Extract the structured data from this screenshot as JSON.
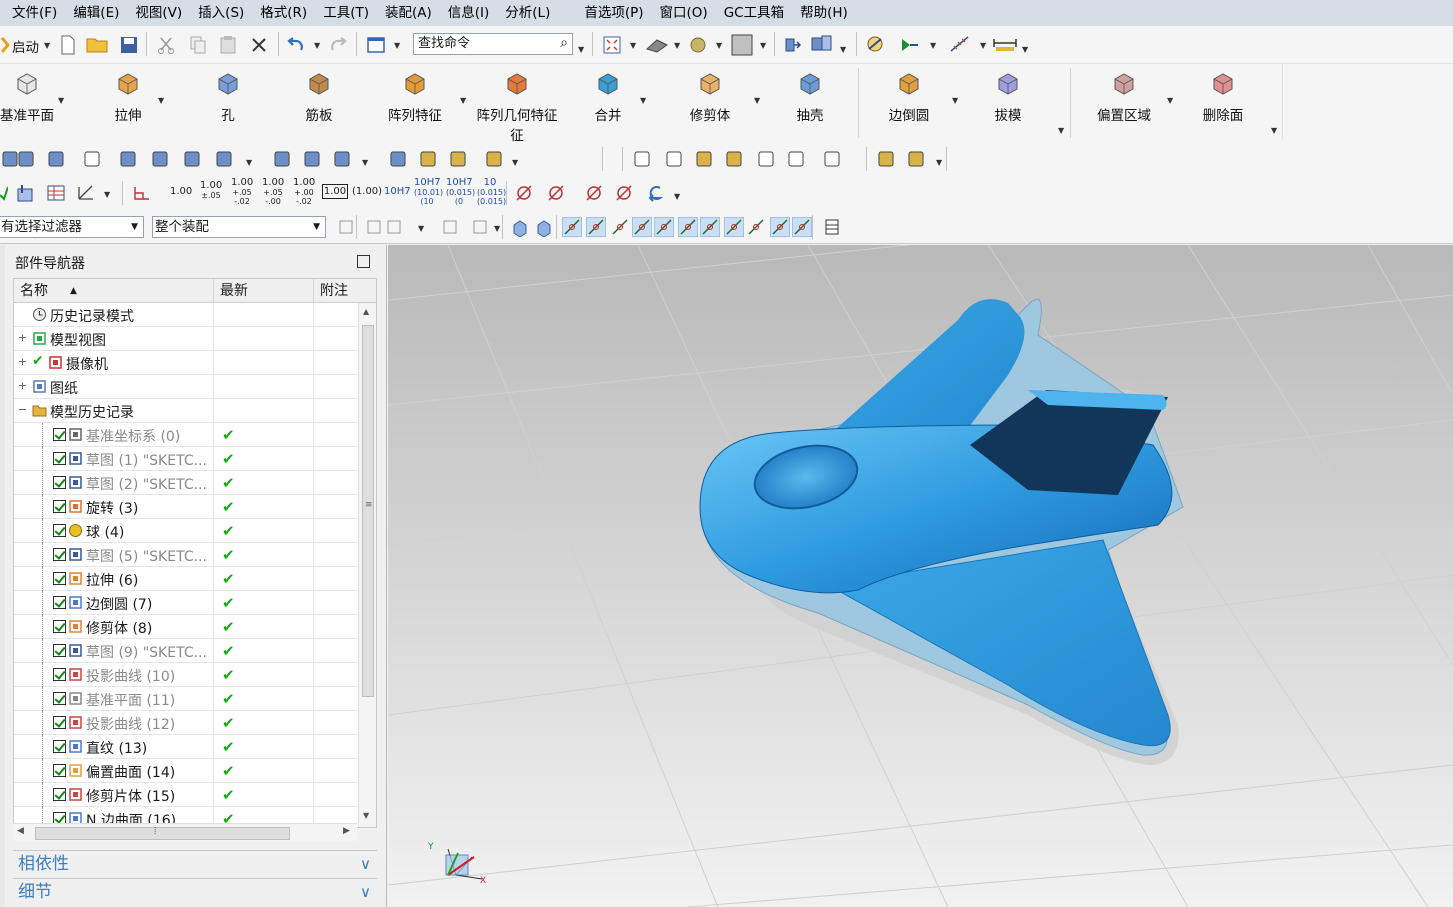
{
  "menu": [
    "文件(F)",
    "编辑(E)",
    "视图(V)",
    "插入(S)",
    "格式(R)",
    "工具(T)",
    "装配(A)",
    "信息(I)",
    "分析(L)",
    "首选项(P)",
    "窗口(O)",
    "GC工具箱",
    "帮助(H)"
  ],
  "toolbar1": {
    "start_label": "启动",
    "search_placeholder": "查找命令"
  },
  "features": [
    "基准平面",
    "拉伸",
    "孔",
    "筋板",
    "阵列特征",
    "阵列几何特征",
    "合并",
    "修剪体",
    "抽壳",
    "边倒圆",
    "拔模",
    "偏置区域",
    "删除面"
  ],
  "feature_dropdown_second_line": "征",
  "pmi_values": {
    "v1": "1.00",
    "v2a": "1.00",
    "v2b": "±.05",
    "v3a": "1.00",
    "v3b": "+.05",
    "v3c": "-.02",
    "v4a": "1.00",
    "v4b": "+.05",
    "v4c": "-.00",
    "v5a": "1.00",
    "v5b": "+.00",
    "v5c": "-.02",
    "box": "1.00",
    "paren": "(1.00)",
    "tol1": "10H7",
    "tol2a": "10H7",
    "tol2b": "(10.01)",
    "tol2c": "(10",
    "tol3a": "10H7",
    "tol3b": "(0.015)",
    "tol3c": "(0",
    "tol4a": "10",
    "tol4b": "(0.015)",
    "tol4c": "(0.015)",
    "fit": "10H7"
  },
  "filters": {
    "select_filter": "有选择过滤器",
    "assembly_scope": "整个装配"
  },
  "navigator": {
    "title": "部件导航器",
    "columns": [
      "名称",
      "最新",
      "附注"
    ],
    "rows": [
      {
        "label": "历史记录模式",
        "icon": "clock-icon",
        "indent": 1,
        "grey": false,
        "checked": false,
        "latest": false,
        "expander": ""
      },
      {
        "label": "模型视图",
        "icon": "model-views-icon",
        "indent": 1,
        "grey": false,
        "checked": false,
        "latest": false,
        "expander": "+"
      },
      {
        "label": "摄像机",
        "icon": "camera-icon",
        "indent": 1,
        "grey": false,
        "checked": false,
        "latest": false,
        "expander": "+",
        "tick": true
      },
      {
        "label": "图纸",
        "icon": "drawing-icon",
        "indent": 1,
        "grey": false,
        "checked": false,
        "latest": false,
        "expander": "+"
      },
      {
        "label": "模型历史记录",
        "icon": "folder-icon",
        "indent": 1,
        "grey": false,
        "checked": false,
        "latest": false,
        "expander": "-"
      },
      {
        "label": "基准坐标系 (0)",
        "icon": "datum-csys-icon",
        "indent": 2,
        "grey": true,
        "checked": true,
        "latest": true
      },
      {
        "label": "草图 (1) \"SKETC...",
        "icon": "sketch-icon",
        "indent": 2,
        "grey": true,
        "checked": true,
        "latest": true
      },
      {
        "label": "草图 (2) \"SKETC...",
        "icon": "sketch-icon",
        "indent": 2,
        "grey": true,
        "checked": true,
        "latest": true
      },
      {
        "label": "旋转 (3)",
        "icon": "revolve-icon",
        "indent": 2,
        "grey": false,
        "checked": true,
        "latest": true
      },
      {
        "label": "球 (4)",
        "icon": "sphere-icon",
        "indent": 2,
        "grey": false,
        "checked": true,
        "latest": true
      },
      {
        "label": "草图 (5) \"SKETC...",
        "icon": "sketch-icon",
        "indent": 2,
        "grey": true,
        "checked": true,
        "latest": true
      },
      {
        "label": "拉伸 (6)",
        "icon": "extrude-icon",
        "indent": 2,
        "grey": false,
        "checked": true,
        "latest": true
      },
      {
        "label": "边倒圆 (7)",
        "icon": "edge-blend-icon",
        "indent": 2,
        "grey": false,
        "checked": true,
        "latest": true
      },
      {
        "label": "修剪体 (8)",
        "icon": "trim-body-icon",
        "indent": 2,
        "grey": false,
        "checked": true,
        "latest": true
      },
      {
        "label": "草图 (9) \"SKETC...",
        "icon": "sketch-icon",
        "indent": 2,
        "grey": true,
        "checked": true,
        "latest": true
      },
      {
        "label": "投影曲线 (10)",
        "icon": "projected-curve-icon",
        "indent": 2,
        "grey": true,
        "checked": true,
        "latest": true
      },
      {
        "label": "基准平面 (11)",
        "icon": "datum-plane-icon",
        "indent": 2,
        "grey": true,
        "checked": true,
        "latest": true
      },
      {
        "label": "投影曲线 (12)",
        "icon": "projected-curve-icon",
        "indent": 2,
        "grey": true,
        "checked": true,
        "latest": true
      },
      {
        "label": "直纹 (13)",
        "icon": "ruled-icon",
        "indent": 2,
        "grey": false,
        "checked": true,
        "latest": true
      },
      {
        "label": "偏置曲面 (14)",
        "icon": "offset-surface-icon",
        "indent": 2,
        "grey": false,
        "checked": true,
        "latest": true
      },
      {
        "label": "修剪片体 (15)",
        "icon": "trimmed-sheet-icon",
        "indent": 2,
        "grey": false,
        "checked": true,
        "latest": true
      },
      {
        "label": "N 边曲面 (16)",
        "icon": "n-sided-surface-icon",
        "indent": 2,
        "grey": false,
        "checked": true,
        "latest": true
      }
    ],
    "sections": [
      "相依性",
      "细节"
    ]
  },
  "viewport": {
    "background_top": "#b9b9b9",
    "background_bottom": "#f2f2f2",
    "model_color": "#2f9ee0",
    "triad_labels": [
      "Y",
      "X"
    ]
  }
}
